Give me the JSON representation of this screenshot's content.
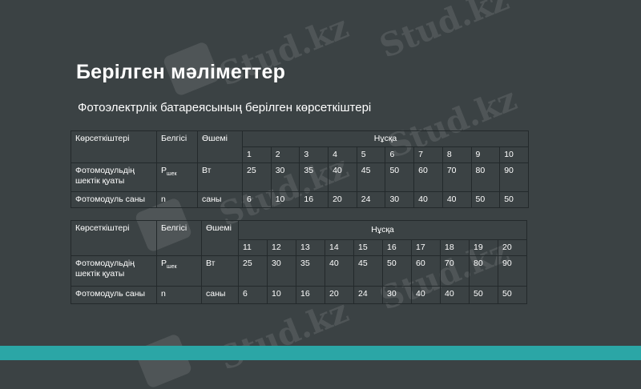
{
  "title": "Берілген мәліметтер",
  "subtitle": "Фотоэлектрлік батареясының  берілген көрсеткіштері",
  "watermark": "Stud.kz",
  "table1": {
    "h_indicator": "Көрсеткіштері",
    "h_symbol": "Белгісі",
    "h_unit": "Өшемі",
    "h_variant": "Нұсқа",
    "variants": [
      "1",
      "2",
      "3",
      "4",
      "5",
      "6",
      "7",
      "8",
      "9",
      "10"
    ],
    "rows": [
      {
        "label": "Фотомодульдің шектік қуаты",
        "symbol": "P",
        "symbol_sub": "шек",
        "unit": "Вт",
        "values": [
          "25",
          "30",
          "35",
          "40",
          "45",
          "50",
          "60",
          "70",
          "80",
          "90"
        ]
      },
      {
        "label": "Фотомодуль саны",
        "symbol": "n",
        "symbol_sub": "",
        "unit": "саны",
        "values": [
          "6",
          "10",
          "16",
          "20",
          "24",
          "30",
          "40",
          "40",
          "50",
          "50"
        ]
      }
    ]
  },
  "table2": {
    "h_indicator": "Көрсеткіштері",
    "h_symbol": "Белгісі",
    "h_unit": "Өшемі",
    "h_variant": "Нұсқа",
    "variants": [
      "11",
      "12",
      "13",
      "14",
      "15",
      "16",
      "17",
      "18",
      "19",
      "20"
    ],
    "rows": [
      {
        "label": "Фотомодульдің шектік қуаты",
        "symbol": "P",
        "symbol_sub": "шек",
        "unit": "Вт",
        "values": [
          "25",
          "30",
          "35",
          "40",
          "45",
          "50",
          "60",
          "70",
          "80",
          "90"
        ]
      },
      {
        "label": "Фотомодуль саны",
        "symbol": "n",
        "symbol_sub": "",
        "unit": "саны",
        "values": [
          "6",
          "10",
          "16",
          "20",
          "24",
          "30",
          "40",
          "40",
          "50",
          "50"
        ]
      }
    ]
  },
  "colors": {
    "background": "#3b4244",
    "accent_bar": "#2ba6a6",
    "text": "#ffffff",
    "table_border": "#23292b"
  }
}
